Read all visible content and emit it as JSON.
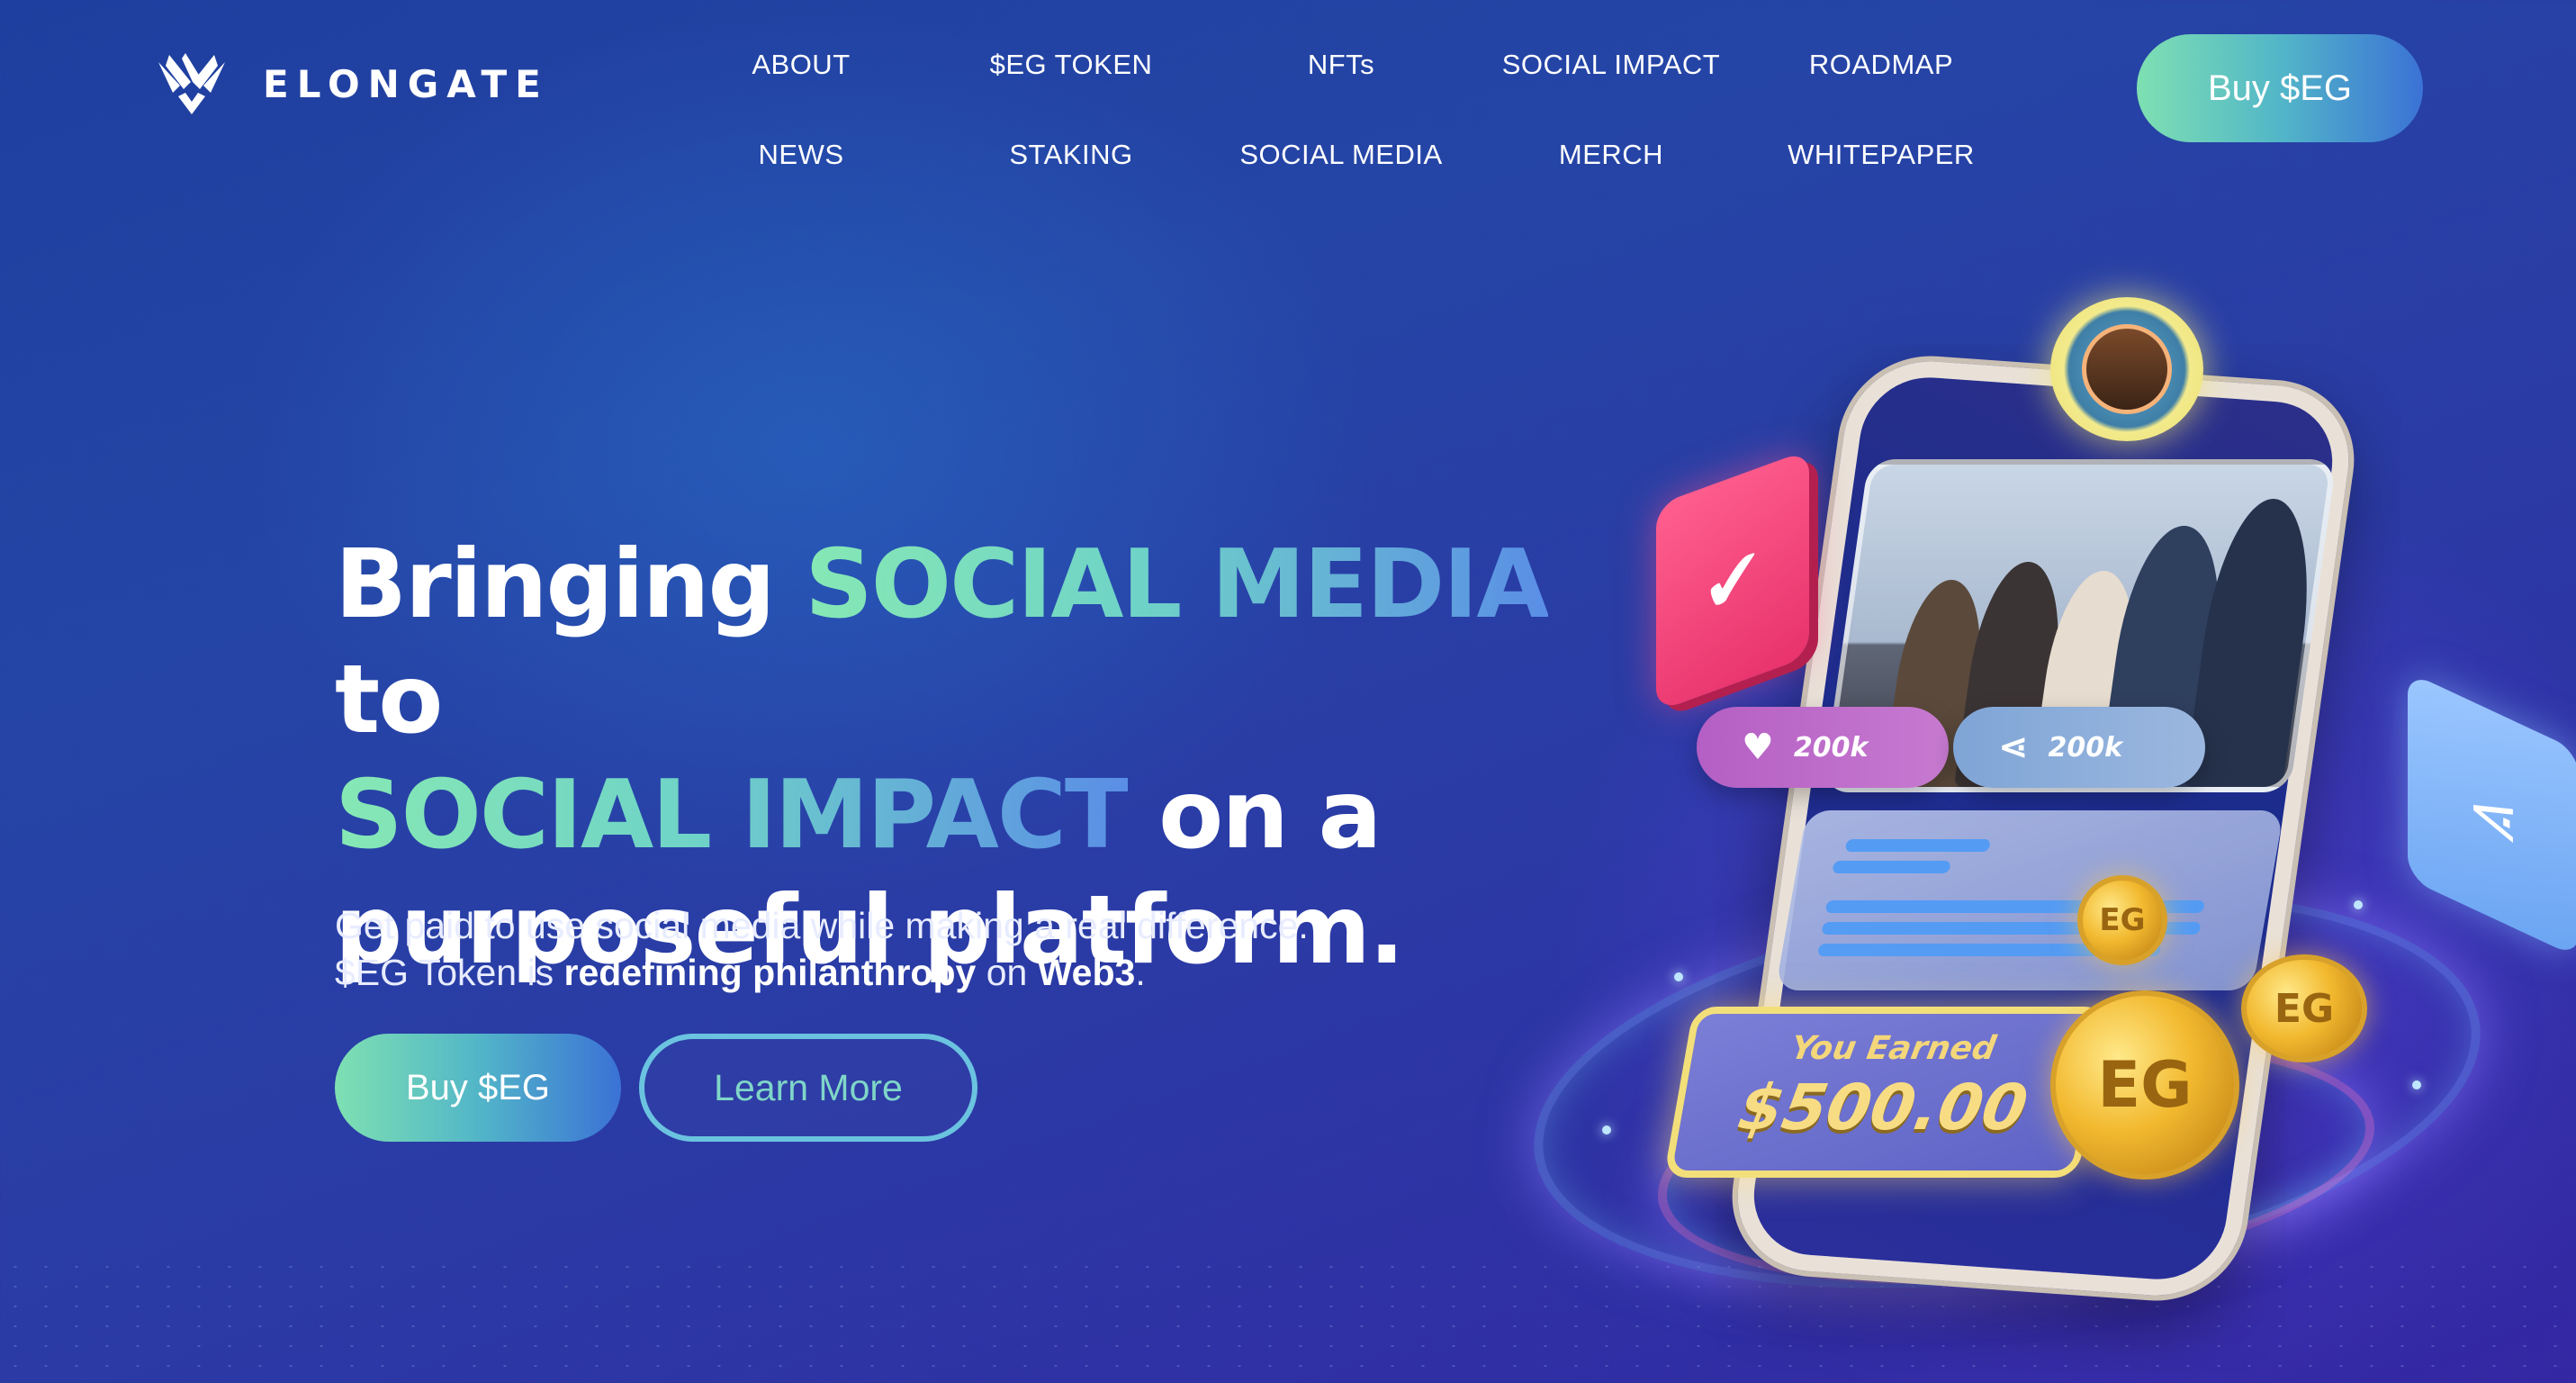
{
  "brand": {
    "name": "ELONGATE"
  },
  "nav": {
    "items": [
      {
        "label": "ABOUT"
      },
      {
        "label": "$EG TOKEN"
      },
      {
        "label": "NFTs"
      },
      {
        "label": "SOCIAL IMPACT"
      },
      {
        "label": "ROADMAP"
      },
      {
        "label": "NEWS"
      },
      {
        "label": "STAKING"
      },
      {
        "label": "SOCIAL MEDIA"
      },
      {
        "label": "MERCH"
      },
      {
        "label": "WHITEPAPER"
      }
    ],
    "buy_label": "Buy $EG"
  },
  "hero": {
    "title_part1": "Bringing ",
    "title_accent1": "SOCIAL MEDIA",
    "title_part2": " to",
    "title_accent2": "SOCIAL IMPACT",
    "title_part3": " on a",
    "title_part4": "purposeful platform.",
    "subtitle_line1": "Get paid to use social media while making a real difference.",
    "subtitle_pre": "$EG Token is ",
    "subtitle_bold1": "redefining philanthropy",
    "subtitle_mid": " on ",
    "subtitle_bold2": "Web3",
    "subtitle_end": ".",
    "buy_label": "Buy $EG",
    "learn_label": "Learn More"
  },
  "illustration": {
    "likes": "200k",
    "shares": "200k",
    "earned_label": "You Earned",
    "earned_amount": "$500.00",
    "icons": [
      "check-icon",
      "heart-icon",
      "share-icon",
      "coin-icon",
      "avatar"
    ]
  },
  "colors": {
    "accent_start": "#86e8b4",
    "accent_end": "#3b72d6",
    "background": "#2545a6"
  }
}
